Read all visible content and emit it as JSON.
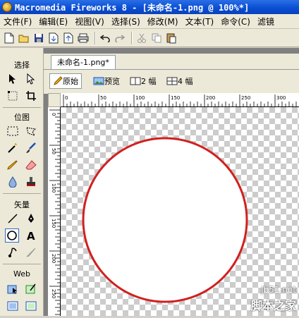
{
  "window": {
    "title": "Macromedia Fireworks 8 - [未命名-1.png @ 100%*]"
  },
  "menu": [
    "文件(F)",
    "编辑(E)",
    "视图(V)",
    "选择(S)",
    "修改(M)",
    "文本(T)",
    "命令(C)",
    "滤镜"
  ],
  "toolbar": {
    "icons": [
      "new-icon",
      "open-icon",
      "save-icon",
      "import-icon",
      "export-icon",
      "print-icon",
      "undo-icon",
      "redo-icon",
      "cut-icon",
      "copy-icon",
      "paste-icon"
    ]
  },
  "tools": {
    "select_heading": "选择",
    "bitmap_heading": "位图",
    "vector_heading": "矢量",
    "web_heading": "Web"
  },
  "document": {
    "tab_label": "未命名-1.png*",
    "views": [
      "原始",
      "预览",
      "2 幅",
      "4 幅"
    ],
    "selected_view": "原始",
    "ruler_h_labels": [
      "0",
      "50",
      "100",
      "150",
      "200",
      "250",
      "300"
    ],
    "ruler_v_labels": [
      "0",
      "50",
      "100",
      "150",
      "200",
      "250"
    ]
  },
  "colors": {
    "circle_stroke": "#d21f1f",
    "accent": "#316ac5"
  },
  "watermark": {
    "line1": "jb51.net",
    "line2": "脚本之家"
  }
}
